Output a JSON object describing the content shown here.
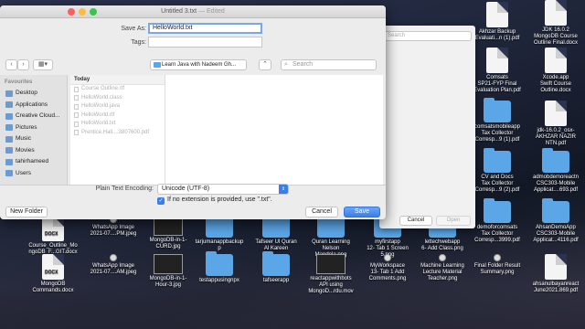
{
  "window": {
    "title": "Untitled 3.txt",
    "title_suffix": "— Edited"
  },
  "form": {
    "save_as_label": "Save As:",
    "save_as_value": "HelloWorld.txt",
    "tags_label": "Tags:",
    "tags_value": ""
  },
  "toolbar": {
    "back_icon": "‹",
    "forward_icon": "›",
    "view_icon": "▦▾",
    "location": "Learn Java with Nadeem Gh...",
    "expand_icon": "⌃",
    "search_placeholder": "Search"
  },
  "sidebar": {
    "heading": "Favourites",
    "items": [
      {
        "label": "Desktop",
        "icon": "desktop-icon"
      },
      {
        "label": "Applications",
        "icon": "applications-icon"
      },
      {
        "label": "Creative Cloud...",
        "icon": "creative-cloud-icon"
      },
      {
        "label": "Pictures",
        "icon": "pictures-icon"
      },
      {
        "label": "Music",
        "icon": "music-icon"
      },
      {
        "label": "Movies",
        "icon": "movies-icon"
      },
      {
        "label": "tahirhameed",
        "icon": "home-icon"
      },
      {
        "label": "Users",
        "icon": "folder-icon"
      }
    ]
  },
  "browser": {
    "column_header": "Today",
    "files": [
      "Course Outline.rtf",
      "HelloWorld.class",
      "HelloWorld.java",
      "HelloWorld.rtf",
      "HelloWorld.txt",
      "Prentice.Hall....3807600.pdf"
    ]
  },
  "options": {
    "encoding_label": "Plain Text Encoding:",
    "encoding_value": "Unicode (UTF-8)",
    "extension_checkbox": "If no extension is provided, use \".txt\"."
  },
  "buttons": {
    "new_folder": "New Folder",
    "cancel": "Cancel",
    "save": "Save"
  },
  "bg_dialog": {
    "search_placeholder": "Search",
    "cancel": "Cancel",
    "open": "Open"
  },
  "desktop_items": [
    {
      "label": "Akhzar Backup\nEvaluati...n (1).pdf"
    },
    {
      "label": "JDK 16.0.2\nMongoDB Course\nOutline Final.docx"
    },
    {
      "label": "Comsats\nSP21-FYP Final\nEvaluation Plan.pdf"
    },
    {
      "label": "Xcode.app\nSwift Course\nOutline.docx"
    },
    {
      "label": "comsatsmobileapp\nTax Collector\nCorresp...9 (1).pdf"
    },
    {
      "label": "jdk-16.0.2_osx-\nAKHZAR NAZIR\nNTN.pdf"
    },
    {
      "label": "CV and Docs\nTax Collector\nCorresp...9 (2).pdf"
    },
    {
      "label": "admobdemoreactn\nCSC303-Mobile\nApplicat....693.pdf"
    },
    {
      "label": "demoforcomsats\nTax Collector\nCorresp...3999.pdf"
    },
    {
      "label": "AhsanDemoApp\nCSC303-Mobile\nApplicat...4116.pdf"
    },
    {
      "label": "Course_Outline_Mo\nngoDB_F...GIT.docx"
    },
    {
      "label": "WhatsApp Image\n2021-07....PM.jpeg"
    },
    {
      "label": "MongoDB-in-1-\nCURD.jpg"
    },
    {
      "label": "tarjumanappbackup\np"
    },
    {
      "label": "Tafseer Ul Quran\nAl Kareen"
    },
    {
      "label": "Quran Learning\nNelson\nMandela.png"
    },
    {
      "label": "myfirstapp\n12- Tab 1 Screen\n5.png"
    },
    {
      "label": "lettechwebapp\n6- Add Class.png"
    },
    {
      "label": "MongoDB\nCommands.docx"
    },
    {
      "label": "WhatsApp Image\n2021-07....AM.jpeg"
    },
    {
      "label": "MongoDB-in-1-\nHour-3.jpg"
    },
    {
      "label": "testappusingnpx"
    },
    {
      "label": "tafseerapp"
    },
    {
      "label": "reactappwithbots\nAPI using\nMongoD...rdu.mov"
    },
    {
      "label": "MyWorkspace\n13- Tab 1 Add\nComments.png"
    },
    {
      "label": "Machine Learning\nLecture Material\nTeacher.png"
    },
    {
      "label": "Final Folder Result\nSummary.png"
    },
    {
      "label": "ahsanulbayanreact\nJune2021.869.pdf"
    }
  ]
}
